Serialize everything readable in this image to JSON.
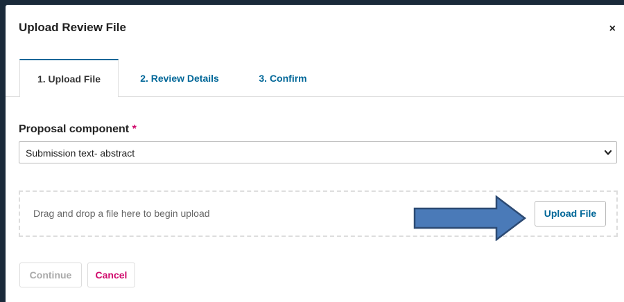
{
  "modal": {
    "title": "Upload Review File",
    "close_glyph": "×"
  },
  "tabs": [
    {
      "label": "1. Upload File",
      "active": true
    },
    {
      "label": "2. Review Details",
      "active": false
    },
    {
      "label": "3. Confirm",
      "active": false
    }
  ],
  "form": {
    "component_label": "Proposal component",
    "required_marker": "*",
    "component_selected": "Submission text- abstract"
  },
  "dropzone": {
    "instruction": "Drag and drop a file here to begin upload",
    "upload_label": "Upload File"
  },
  "footer": {
    "continue_label": "Continue",
    "cancel_label": "Cancel"
  },
  "colors": {
    "link": "#006798",
    "required": "#d00a6c",
    "arrow_fill": "#4a7ab8",
    "arrow_stroke": "#2c4a73"
  },
  "icons": [
    "close-icon",
    "chevron-down-icon",
    "arrow-right-icon"
  ]
}
